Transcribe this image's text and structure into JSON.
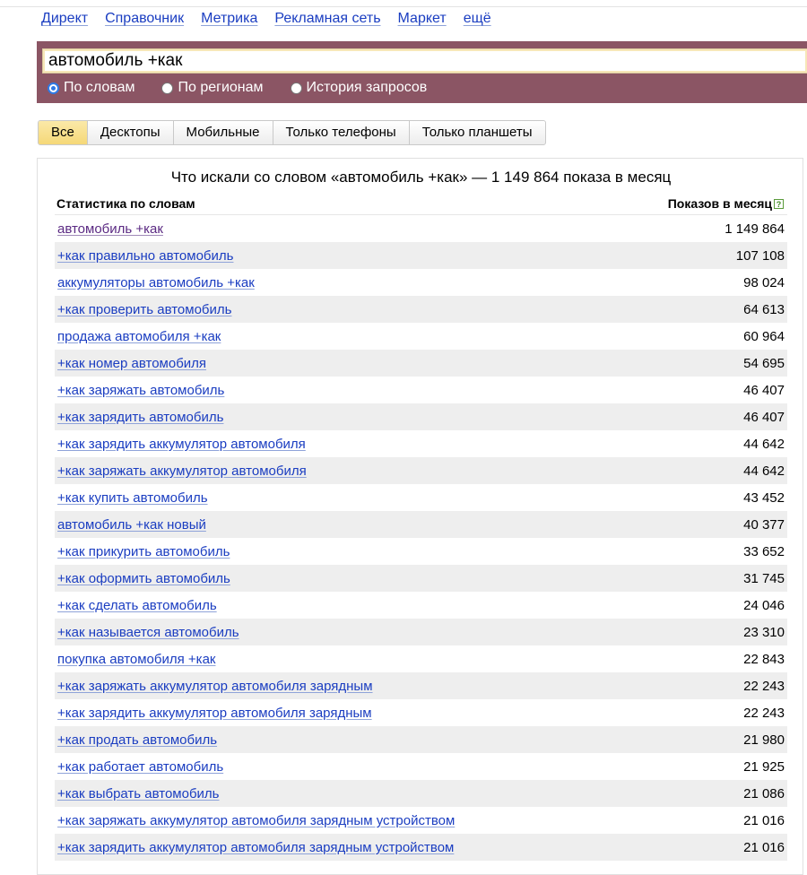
{
  "top_nav": [
    "Директ",
    "Справочник",
    "Метрика",
    "Рекламная сеть",
    "Маркет",
    "ещё"
  ],
  "search": {
    "value": "автомобиль +как",
    "modes": [
      {
        "label": "По словам",
        "checked": true
      },
      {
        "label": "По регионам",
        "checked": false
      },
      {
        "label": "История запросов",
        "checked": false
      }
    ]
  },
  "device_tabs": [
    {
      "label": "Все",
      "active": true
    },
    {
      "label": "Десктопы",
      "active": false
    },
    {
      "label": "Мобильные",
      "active": false
    },
    {
      "label": "Только телефоны",
      "active": false
    },
    {
      "label": "Только планшеты",
      "active": false
    }
  ],
  "results": {
    "title": "Что искали со словом «автомобиль +как» — 1 149 864 показа в месяц",
    "col_left": "Статистика по словам",
    "col_right": "Показов в месяц",
    "help_glyph": "?",
    "rows": [
      {
        "kw": "автомобиль +как",
        "count": "1 149 864",
        "visited": true
      },
      {
        "kw": "+как правильно автомобиль",
        "count": "107 108"
      },
      {
        "kw": "аккумуляторы автомобиль +как",
        "count": "98 024"
      },
      {
        "kw": "+как проверить автомобиль",
        "count": "64 613"
      },
      {
        "kw": "продажа автомобиля +как",
        "count": "60 964"
      },
      {
        "kw": "+как номер автомобиля",
        "count": "54 695"
      },
      {
        "kw": "+как заряжать автомобиль",
        "count": "46 407"
      },
      {
        "kw": "+как зарядить автомобиль",
        "count": "46 407"
      },
      {
        "kw": "+как зарядить аккумулятор автомобиля",
        "count": "44 642"
      },
      {
        "kw": "+как заряжать аккумулятор автомобиля",
        "count": "44 642"
      },
      {
        "kw": "+как купить автомобиль",
        "count": "43 452"
      },
      {
        "kw": "автомобиль +как новый",
        "count": "40 377"
      },
      {
        "kw": "+как прикурить автомобиль",
        "count": "33 652"
      },
      {
        "kw": "+как оформить автомобиль",
        "count": "31 745"
      },
      {
        "kw": "+как сделать автомобиль",
        "count": "24 046"
      },
      {
        "kw": "+как называется автомобиль",
        "count": "23 310"
      },
      {
        "kw": "покупка автомобиля +как",
        "count": "22 843"
      },
      {
        "kw": "+как заряжать аккумулятор автомобиля зарядным",
        "count": "22 243"
      },
      {
        "kw": "+как зарядить аккумулятор автомобиля зарядным",
        "count": "22 243"
      },
      {
        "kw": "+как продать автомобиль",
        "count": "21 980"
      },
      {
        "kw": "+как работает автомобиль",
        "count": "21 925"
      },
      {
        "kw": "+как выбрать автомобиль",
        "count": "21 086"
      },
      {
        "kw": "+как заряжать аккумулятор автомобиля зарядным устройством",
        "count": "21 016"
      },
      {
        "kw": "+как зарядить аккумулятор автомобиля зарядным устройством",
        "count": "21 016"
      }
    ]
  }
}
